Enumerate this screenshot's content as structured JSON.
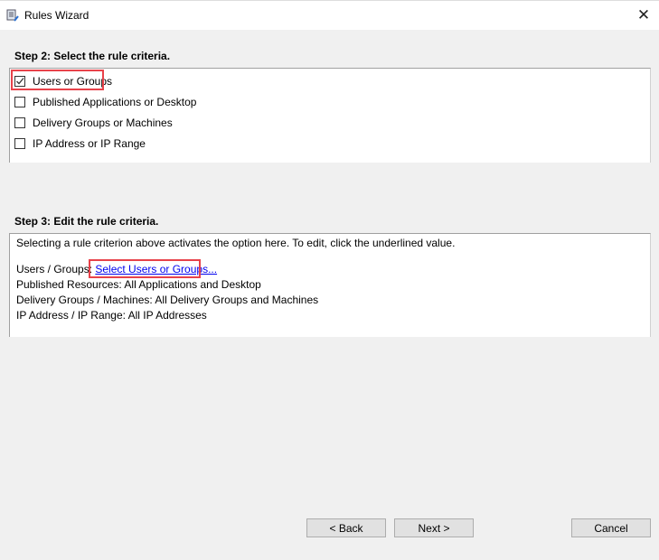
{
  "window": {
    "title": "Rules Wizard",
    "icon": "rules-wizard-icon",
    "close_icon": "close-icon"
  },
  "step2": {
    "heading": "Step 2: Select the rule criteria.",
    "criteria": [
      {
        "label": "Users or Groups",
        "checked": true
      },
      {
        "label": "Published Applications or Desktop",
        "checked": false
      },
      {
        "label": "Delivery Groups or Machines",
        "checked": false
      },
      {
        "label": "IP Address or IP Range",
        "checked": false
      }
    ]
  },
  "step3": {
    "heading": "Step 3: Edit the rule criteria.",
    "intro": "Selecting a rule criterion above activates the option here. To edit, click the underlined value.",
    "users_label": "Users / Groups: ",
    "users_link": "Select Users or Groups...",
    "resources": "Published Resources: All Applications and Desktop",
    "delivery": "Delivery Groups / Machines: All Delivery Groups and Machines",
    "ip": "IP Address / IP Range: All IP Addresses"
  },
  "buttons": {
    "back": "< Back",
    "next": "Next >",
    "cancel": "Cancel"
  },
  "colors": {
    "highlight": "#e8424a",
    "link": "#0000ee"
  }
}
